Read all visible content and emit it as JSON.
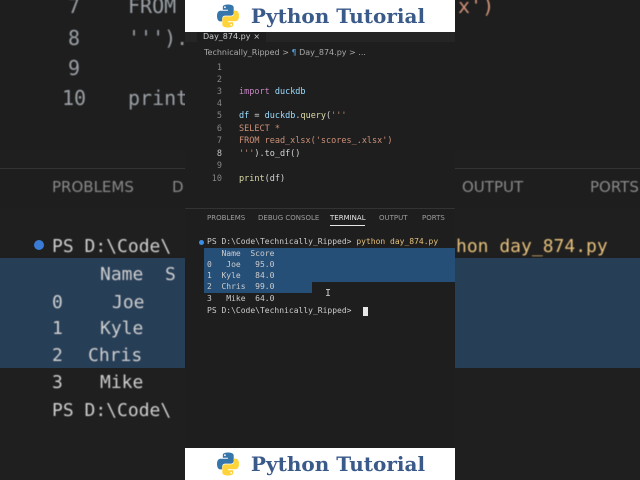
{
  "background": {
    "code_lines": [
      {
        "num": "7",
        "text": "FROM"
      },
      {
        "num": "8",
        "text": "''')."
      },
      {
        "num": "9",
        "text": ""
      },
      {
        "num": "10",
        "text": "print"
      }
    ],
    "code_right_fragment": "x')",
    "panel_tabs_left": [
      "PROBLEMS",
      "D"
    ],
    "panel_tabs_right": [
      "OUTPUT",
      "PORTS"
    ],
    "terminal_prompt": "PS D:\\Code\\",
    "terminal_right": "hon day_874.py",
    "table_header": "Name  S",
    "rows": [
      {
        "idx": "0",
        "name": "Joe"
      },
      {
        "idx": "1",
        "name": "Kyle"
      },
      {
        "idx": "2",
        "name": "Chris"
      },
      {
        "idx": "3",
        "name": "Mike"
      }
    ],
    "prompt_bottom": "PS D:\\Code\\"
  },
  "banner": {
    "title": "Python Tutorial",
    "logo_colors": {
      "blue": "#3776ab",
      "yellow": "#ffd43b"
    }
  },
  "editor": {
    "tab_label": "Day_874.py",
    "tab_close": "×",
    "breadcrumb": {
      "folder": "Technically_Ripped",
      "sep": ">",
      "file": "Day_874.py",
      "more": "> ..."
    },
    "line_numbers": [
      "1",
      "2",
      "3",
      "4",
      "5",
      "6",
      "7",
      "8",
      "9",
      "10"
    ],
    "current_line": "8",
    "lines": {
      "l3_kw": "import",
      "l3_mod": " duckdb",
      "l5_var": "df",
      "l5_eq": " = ",
      "l5_mod": "duckdb",
      "l5_dot": ".",
      "l5_fn": "query",
      "l5_open": "(",
      "l5_str": "'''",
      "l6": "SELECT *",
      "l7": "FROM read_xlsx('scores_.xlsx')",
      "l8_str": "'''",
      "l8_rest": ").to_df()",
      "l10_fn": "print",
      "l10_rest": "(df)"
    }
  },
  "panel": {
    "tabs": [
      "PROBLEMS",
      "DEBUG CONSOLE",
      "TERMINAL",
      "OUTPUT",
      "PORTS"
    ],
    "active_tab": "TERMINAL"
  },
  "terminal": {
    "prompt1": "PS D:\\Code\\Technically_Ripped> ",
    "command": "python day_874.py",
    "header": "   Name  Score",
    "rows": [
      "0   Joe   95.0",
      "1  Kyle   84.0",
      "2  Chris  99.0",
      "3   Mike  64.0"
    ],
    "prompt2": "PS D:\\Code\\Technically_Ripped> "
  }
}
